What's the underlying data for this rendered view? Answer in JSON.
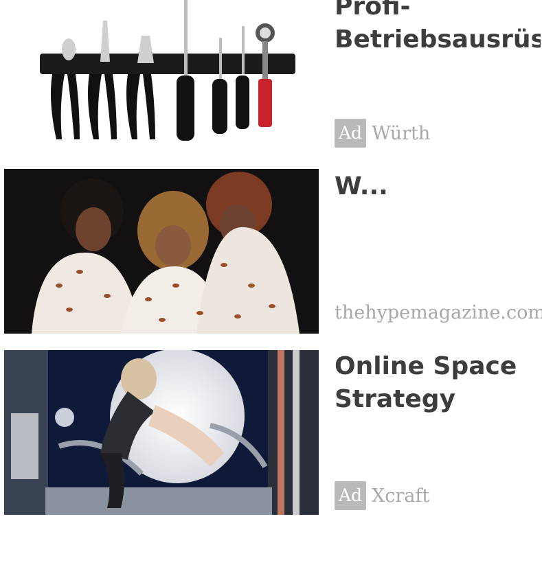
{
  "cards": [
    {
      "title": "Profi-\nBetriebsausrüs",
      "badge": "Ad",
      "source": "Würth",
      "image": "tool-rack-image"
    },
    {
      "title": "W...",
      "badge": "",
      "source": "thehypemagazine.com",
      "image": "three-women-photo"
    },
    {
      "title": "Online Space\nStrategy",
      "badge": "Ad",
      "source": "Xcraft",
      "image": "space-fantasy-image"
    }
  ],
  "colors": {
    "title": "#3d3d3d",
    "source": "#a8a8a8",
    "badge_bg": "#b9b9b9",
    "badge_text": "#ffffff"
  }
}
